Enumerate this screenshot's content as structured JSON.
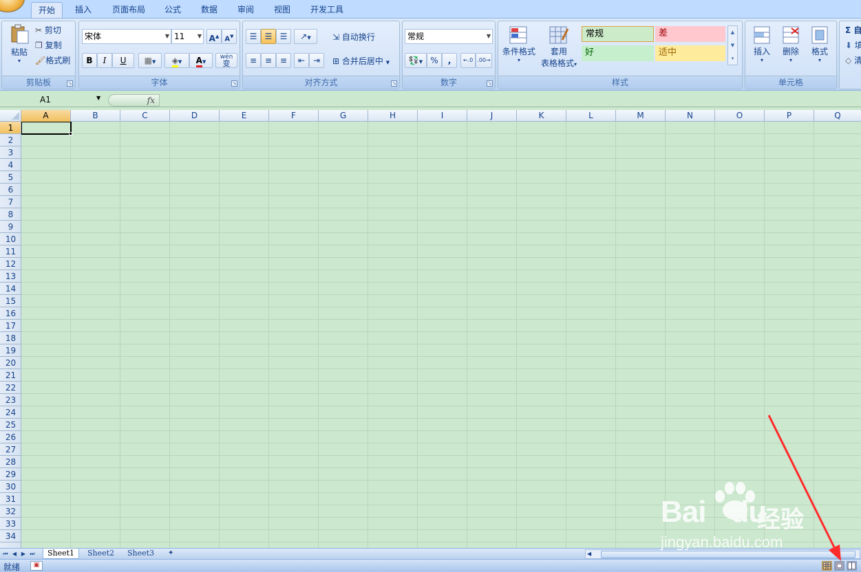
{
  "tabs": [
    {
      "label": "开始",
      "active": true
    },
    {
      "label": "插入"
    },
    {
      "label": "页面布局"
    },
    {
      "label": "公式"
    },
    {
      "label": "数据"
    },
    {
      "label": "审阅"
    },
    {
      "label": "视图"
    },
    {
      "label": "开发工具"
    }
  ],
  "clipboard": {
    "paste": "粘贴",
    "cut": "剪切",
    "copy": "复制",
    "format_painter": "格式刷",
    "group": "剪贴板"
  },
  "font": {
    "name": "宋体",
    "size": "11",
    "bold": "B",
    "italic": "I",
    "underline": "U",
    "wen": "wén",
    "wen2": "变",
    "group": "字体"
  },
  "alignment": {
    "wrap": "自动换行",
    "merge": "合并后居中",
    "group": "对齐方式"
  },
  "number": {
    "format": "常规",
    "percent": "%",
    "comma": ",",
    "group": "数字"
  },
  "styles": {
    "conditional": "条件格式",
    "table_fmt_1": "套用",
    "table_fmt_2": "表格格式",
    "normal": "常规",
    "bad": "差",
    "good": "好",
    "neutral": "适中",
    "group": "样式"
  },
  "cells": {
    "insert": "插入",
    "delete": "删除",
    "format": "格式",
    "group": "单元格"
  },
  "editing": {
    "sigma": "Σ",
    "e1": "自",
    "e2": "填",
    "e3": "清"
  },
  "formula_bar": {
    "name_box": "A1",
    "fx": "fx",
    "value": ""
  },
  "columns": [
    "A",
    "B",
    "C",
    "D",
    "E",
    "F",
    "G",
    "H",
    "I",
    "J",
    "K",
    "L",
    "M",
    "N",
    "O",
    "P",
    "Q"
  ],
  "rows": [
    "1",
    "2",
    "3",
    "4",
    "5",
    "6",
    "7",
    "8",
    "9",
    "10",
    "11",
    "12",
    "13",
    "14",
    "15",
    "16",
    "17",
    "18",
    "19",
    "20",
    "21",
    "22",
    "23",
    "24",
    "25",
    "26",
    "27",
    "28",
    "29",
    "30",
    "31",
    "32",
    "33",
    "34"
  ],
  "active_cell": "A1",
  "sheets": [
    "Sheet1",
    "Sheet2",
    "Sheet3"
  ],
  "status": "就绪",
  "watermark": {
    "brand": "Bai",
    "brand2": "du",
    "cn": "经验",
    "url": "jingyan.baidu.com"
  },
  "colors": {
    "workspace": "#cce8cf",
    "ribbon": "#c6dbf6",
    "accent": "#15428b",
    "annotation": "#ff2a2a"
  }
}
